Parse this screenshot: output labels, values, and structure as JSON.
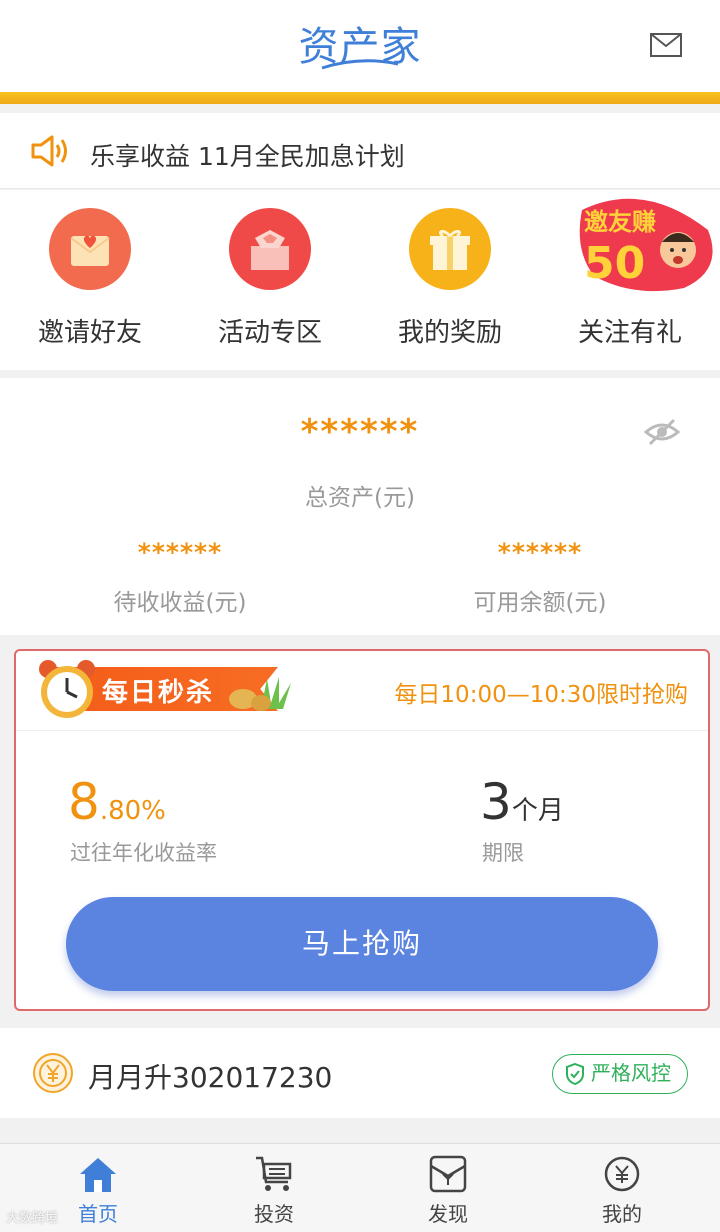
{
  "header": {
    "logo_text": "资产家",
    "mail_icon": "mail-icon"
  },
  "notice": {
    "icon": "speaker-icon",
    "text": "乐享收益 11月全民加息计划"
  },
  "quick_actions": [
    {
      "label": "邀请好友",
      "icon": "invite-envelope-icon",
      "color": "#f26b4f"
    },
    {
      "label": "活动专区",
      "icon": "gift-box-icon",
      "color": "#ef4a48"
    },
    {
      "label": "我的奖励",
      "icon": "gift-icon",
      "color": "#f7b21a"
    },
    {
      "label": "关注有礼",
      "icon": "promo-banner-icon",
      "color": "#ef3a4e"
    }
  ],
  "promo": {
    "text": "邀友赚",
    "number": "50"
  },
  "assets": {
    "total_value": "******",
    "total_label": "总资产(元)",
    "pending_value": "******",
    "pending_label": "待收收益(元)",
    "available_value": "******",
    "available_label": "可用余额(元)"
  },
  "flash_sale": {
    "title": "每日秒杀",
    "time_text": "每日10:00—10:30限时抢购",
    "rate_int": "8",
    "rate_dec": ".80%",
    "rate_label": "过往年化收益率",
    "term_num": "3",
    "term_unit": "个月",
    "term_label": "期限",
    "button_label": "马上抢购"
  },
  "product": {
    "name": "月月升302017230",
    "badge": "严格风控"
  },
  "tabs": [
    {
      "label": "首页",
      "icon": "home-icon",
      "active": true
    },
    {
      "label": "投资",
      "icon": "cart-icon",
      "active": false
    },
    {
      "label": "发现",
      "icon": "discover-icon",
      "active": false
    },
    {
      "label": "我的",
      "icon": "user-coin-icon",
      "active": false
    }
  ],
  "colors": {
    "accent_orange": "#f0920f",
    "brand_blue": "#3f7fd8",
    "button_blue": "#5b83e0",
    "risk_green": "#2fb15a"
  },
  "watermark": "大数跨境"
}
